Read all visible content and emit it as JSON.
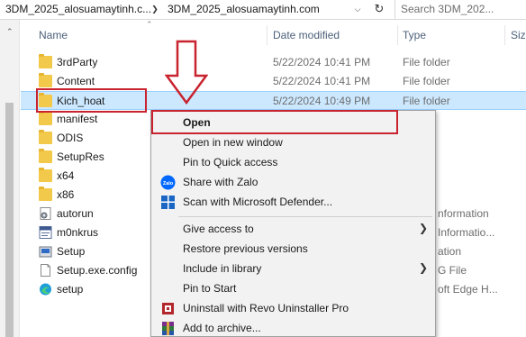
{
  "address": {
    "crumb1": "3DM_2025_alosuamaytinh.c...",
    "crumb2": "3DM_2025_alosuamaytinh.com",
    "search_placeholder": "Search 3DM_202..."
  },
  "columns": {
    "name": "Name",
    "date": "Date modified",
    "type": "Type",
    "size": "Siz"
  },
  "files": [
    {
      "name": "3rdParty",
      "date": "5/22/2024 10:41 PM",
      "type": "File folder",
      "icon": "folder-icon"
    },
    {
      "name": "Content",
      "date": "5/22/2024 10:41 PM",
      "type": "File folder",
      "icon": "folder-icon"
    },
    {
      "name": "Kich_hoat",
      "date": "5/22/2024 10:49 PM",
      "type": "File folder",
      "icon": "folder-icon",
      "selected": true
    },
    {
      "name": "manifest",
      "date": "",
      "type": "",
      "icon": "folder-icon"
    },
    {
      "name": "ODIS",
      "date": "",
      "type": "",
      "icon": "folder-icon"
    },
    {
      "name": "SetupRes",
      "date": "",
      "type": "",
      "icon": "folder-icon"
    },
    {
      "name": "x64",
      "date": "",
      "type": "",
      "icon": "folder-icon"
    },
    {
      "name": "x86",
      "date": "",
      "type": "",
      "icon": "folder-icon"
    },
    {
      "name": "autorun",
      "date": "",
      "type": "nformation",
      "icon": "settings-file-icon"
    },
    {
      "name": "m0nkrus",
      "date": "",
      "type": "Informatio...",
      "icon": "info-file-icon"
    },
    {
      "name": "Setup",
      "date": "",
      "type": "ation",
      "icon": "setup-app-icon"
    },
    {
      "name": "Setup.exe.config",
      "date": "",
      "type": "G File",
      "icon": "config-file-icon"
    },
    {
      "name": "setup",
      "date": "",
      "type": "oft Edge H...",
      "icon": "edge-html-icon"
    }
  ],
  "context_menu": {
    "open": "Open",
    "open_new_window": "Open in new window",
    "pin_quick_access": "Pin to Quick access",
    "share_zalo": "Share with Zalo",
    "scan_defender": "Scan with Microsoft Defender...",
    "give_access": "Give access to",
    "restore_versions": "Restore previous versions",
    "include_library": "Include in library",
    "pin_start": "Pin to Start",
    "uninstall_revo": "Uninstall with Revo Uninstaller Pro",
    "add_archive": "Add to archive...",
    "zalo_icon_text": "Zalo"
  },
  "colors": {
    "highlight_red": "#c8232f",
    "selection_blue": "#cce8ff",
    "folder_yellow": "#f3c94b"
  }
}
